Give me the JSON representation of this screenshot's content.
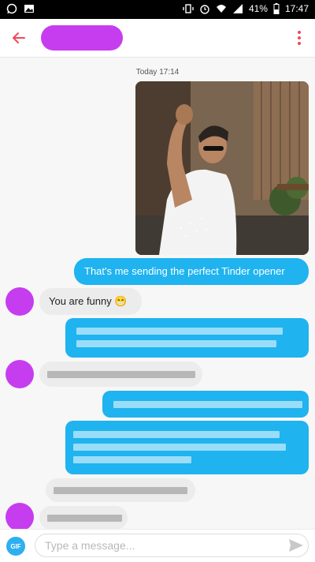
{
  "status_bar": {
    "battery": "41%",
    "time": "17:47"
  },
  "header": {
    "back_icon": "arrow-left-icon",
    "menu_icon": "kebab-menu-icon",
    "accent": "#f0485a"
  },
  "conversation": {
    "timestamp": "Today 17:14",
    "caption": "That's me sending the perfect Tinder opener",
    "reply": "You are funny 😁"
  },
  "composer": {
    "gif_label": "GIF",
    "placeholder": "Type a message..."
  },
  "colors": {
    "outgoing": "#1fb3ef",
    "incoming": "#ececec",
    "redaction": "#c63df0"
  }
}
